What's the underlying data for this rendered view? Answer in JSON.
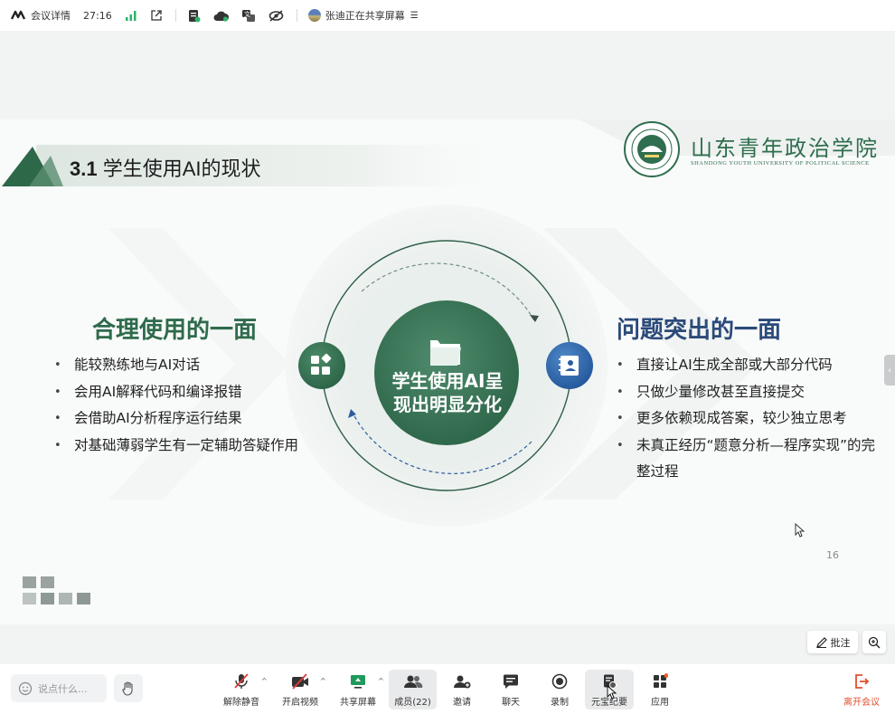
{
  "topbar": {
    "meeting_info": "会议详情",
    "timer": "27:16",
    "sharing_status": "张迪正在共享屏幕"
  },
  "slide": {
    "title_num": "3.1",
    "title_text": " 学生使用AI的现状",
    "school_name": "山东青年政治学院",
    "school_name_en": "SHANDONG YOUTH UNIVERSITY OF POLITICAL SCIENCE",
    "left_heading": "合理使用的一面",
    "left_bullets": [
      "能较熟练地与AI对话",
      "会用AI解释代码和编译报错",
      "会借助AI分析程序运行结果",
      "对基础薄弱学生有一定辅助答疑作用"
    ],
    "right_heading": "问题突出的一面",
    "right_bullets": [
      "直接让AI生成全部或大部分代码",
      "只做少量修改甚至直接提交",
      "更多依赖现成答案，较少独立思考",
      "未真正经历“题意分析—程序实现”的完整过程"
    ],
    "center_line1": "学生使用AI呈",
    "center_line2": "现出明显分化",
    "page_number": "16",
    "colors": {
      "green": "#2e6b4b",
      "blue": "#2b5d9e"
    }
  },
  "overlay": {
    "annotate_label": "批注"
  },
  "bottombar": {
    "chat_placeholder": "说点什么...",
    "tools": {
      "mute": "解除静音",
      "video": "开启视频",
      "share": "共享屏幕",
      "members": "成员(22)",
      "invite": "邀请",
      "chat": "聊天",
      "record": "录制",
      "summary": "元宝纪要",
      "apps": "应用"
    },
    "leave": "离开会议"
  }
}
